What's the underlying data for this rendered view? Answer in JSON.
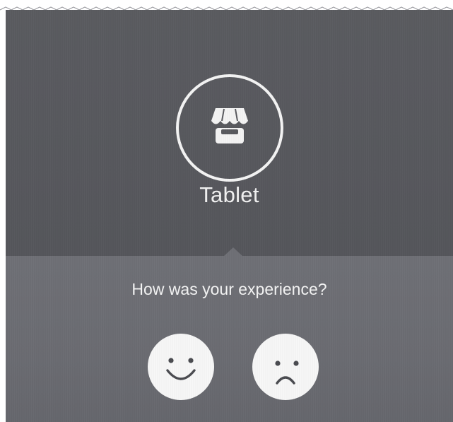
{
  "device": {
    "icon": "storefront-icon",
    "label": "Tablet"
  },
  "feedback": {
    "question": "How was your experience?",
    "options": [
      {
        "icon": "happy-face-icon",
        "sentiment": "positive"
      },
      {
        "icon": "sad-face-icon",
        "sentiment": "negative"
      }
    ]
  },
  "colors": {
    "top_panel": "#58595e",
    "bottom_panel": "#6c6d73",
    "foreground": "#f4f4f4",
    "face_features": "#4a4b50"
  }
}
